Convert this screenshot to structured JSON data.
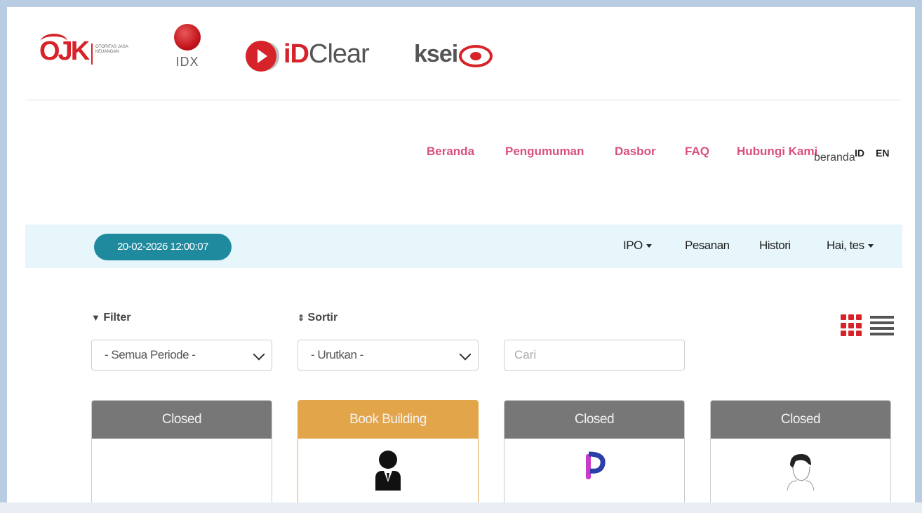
{
  "logos": {
    "ojk": {
      "mark": "OJK",
      "sub": "OTORITAS JASA KEUANGAN"
    },
    "idx": {
      "label": "IDX"
    },
    "idclear": {
      "prefix": "iD",
      "name": "Clear"
    },
    "ksei": {
      "name": "ksei"
    }
  },
  "topnav": {
    "items": [
      "Beranda",
      "Pengumuman",
      "Dasbor",
      "FAQ",
      "Hubungi Kami"
    ],
    "overlay_text": "beranda",
    "lang": [
      "ID",
      "EN"
    ],
    "color": "#d9507e"
  },
  "bar": {
    "datetime": "20-02-2026 12:00:07",
    "menu": {
      "ipo": "IPO",
      "pesanan": "Pesanan",
      "histori": "Histori",
      "user": "Hai, tes"
    },
    "background": "#e6f6fb",
    "pill_color": "#1f8a9e"
  },
  "controls": {
    "filter_label": "Filter",
    "filter_icon": "funnel-icon",
    "sort_label": "Sortir",
    "sort_icon": "sort-arrows-icon",
    "period_value": "- Semua Periode -",
    "sort_value": "- Urutkan -",
    "search_placeholder": "Cari"
  },
  "cards": [
    {
      "status": "Closed",
      "icon": "none"
    },
    {
      "status": "Book Building",
      "icon": "person-icon"
    },
    {
      "status": "Closed",
      "icon": "p-logo-icon"
    },
    {
      "status": "Closed",
      "icon": "sketch-face-icon"
    }
  ]
}
